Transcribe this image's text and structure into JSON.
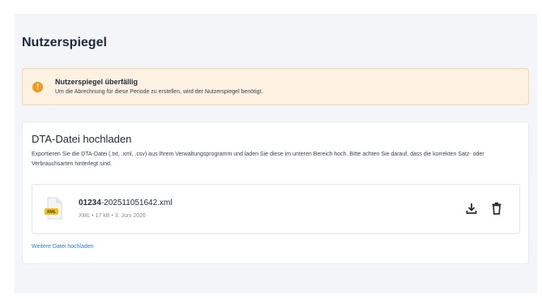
{
  "page": {
    "title": "Nutzerspiegel"
  },
  "alert": {
    "icon": "warning-icon",
    "icon_glyph": "!",
    "title": "Nutzerspiegel überfällig",
    "text": "Um die Abrechnung für diese Periode zu erstellen, wird der Nutzerspiegel benötigt.",
    "color": "#f29a1b"
  },
  "upload_card": {
    "title": "DTA-Datei hochladen",
    "description": "Exportieren Sie die DTA-Datei (.txt, .xml, .csv) aus Ihrem Verwaltungsprogramm und laden Sie diese im unteren Bereich hoch. Bitte achten Sie darauf, dass die korrekten Satz- oder Verbrauchsarten hinterlegt sind.",
    "file": {
      "icon": "xml-file-icon",
      "badge": "XML",
      "name_prefix": "01234",
      "name_rest": "-202511051642.xml",
      "meta": "XML • 17 kB • 3. Juni 2026"
    },
    "actions": {
      "download_icon": "download-icon",
      "delete_icon": "trash-icon"
    },
    "more_link": "Weitere Datei hochladen",
    "link_color": "#2b7de0"
  }
}
